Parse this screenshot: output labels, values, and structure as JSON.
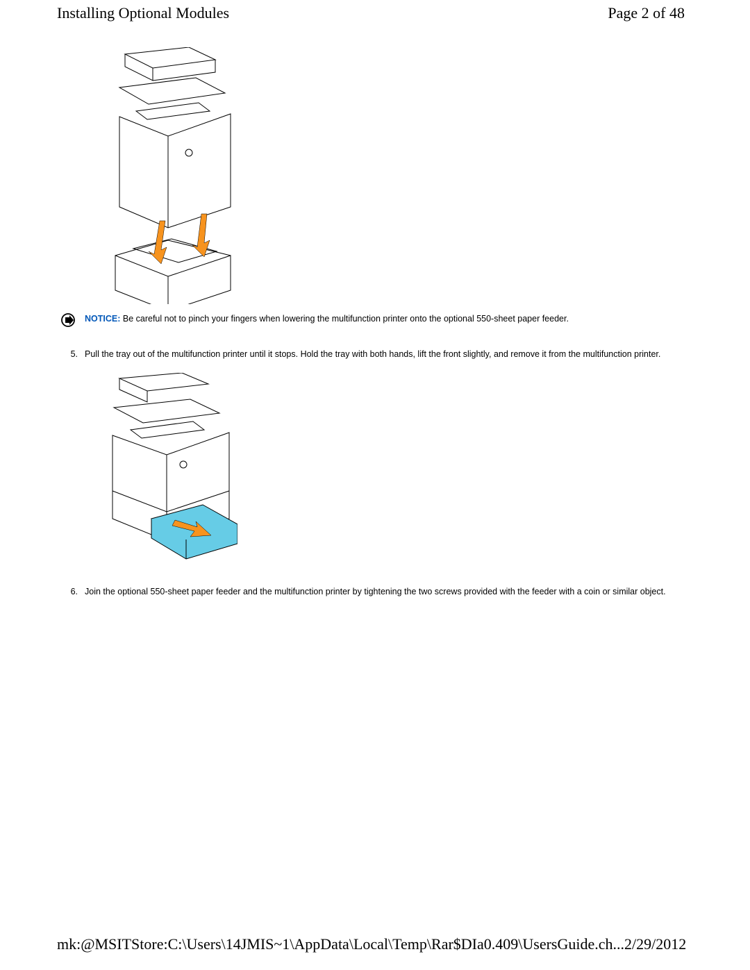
{
  "header": {
    "title": "Installing Optional Modules",
    "page_label": "Page 2 of 48"
  },
  "notice": {
    "label": "NOTICE:",
    "text": "Be careful not to pinch your fingers when lowering the multifunction printer onto the optional 550-sheet paper feeder."
  },
  "steps": [
    {
      "num": "5.",
      "text": "Pull the tray out of the multifunction printer until it stops. Hold the tray with both hands, lift the front slightly, and remove it from the multifunction printer."
    },
    {
      "num": "6.",
      "text": "Join the optional 550-sheet paper feeder and the multifunction printer by tightening the two screws provided with the feeder with a coin or similar object."
    }
  ],
  "footer": {
    "path": "mk:@MSITStore:C:\\Users\\14JMIS~1\\AppData\\Local\\Temp\\Rar$DIa0.409\\UsersGuide.ch...",
    "date": "2/29/2012"
  },
  "colors": {
    "arrow": "#f7931e",
    "notice_label": "#0057b8",
    "tray_highlight": "#66cce6"
  }
}
